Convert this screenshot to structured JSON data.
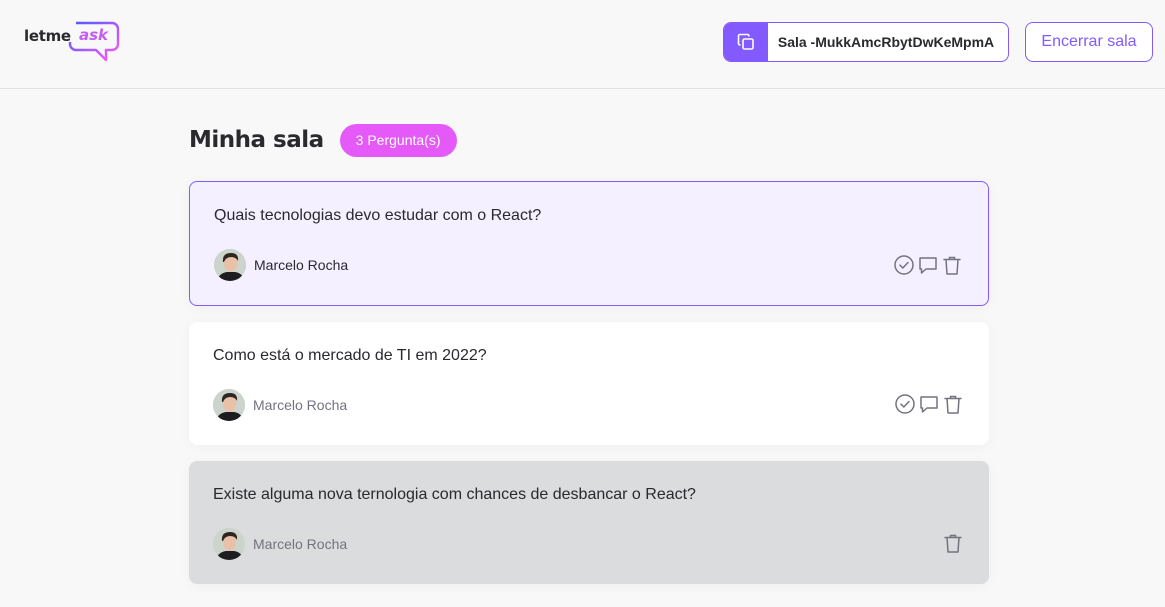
{
  "header": {
    "logo": {
      "text_part1": "letme",
      "text_part2": "ask"
    },
    "room_code": {
      "label": "Sala -MukkAmcRbytDwKeMpmA",
      "icon": "copy-icon"
    },
    "close_room_label": "Encerrar sala"
  },
  "room": {
    "title": "Minha sala",
    "count_label": "3 Pergunta(s)"
  },
  "questions": [
    {
      "content": "Quais tecnologias devo estudar com o React?",
      "author": "Marcelo Rocha",
      "state": "highlighted",
      "actions": [
        "check-circle-icon",
        "answer-icon",
        "trash-icon"
      ]
    },
    {
      "content": "Como está o mercado de TI em 2022?",
      "author": "Marcelo Rocha",
      "state": "default",
      "actions": [
        "check-circle-icon",
        "answer-icon",
        "trash-icon"
      ]
    },
    {
      "content": "Existe alguma nova ternologia com chances de desbancar o React?",
      "author": "Marcelo Rocha",
      "state": "answered",
      "actions": [
        "trash-icon"
      ]
    }
  ],
  "colors": {
    "accent": "#835afd",
    "badge": "#e559f9",
    "highlight_bg": "#f4f0ff",
    "answered_bg": "#dbdcdd",
    "page_bg": "#f8f8f8"
  }
}
